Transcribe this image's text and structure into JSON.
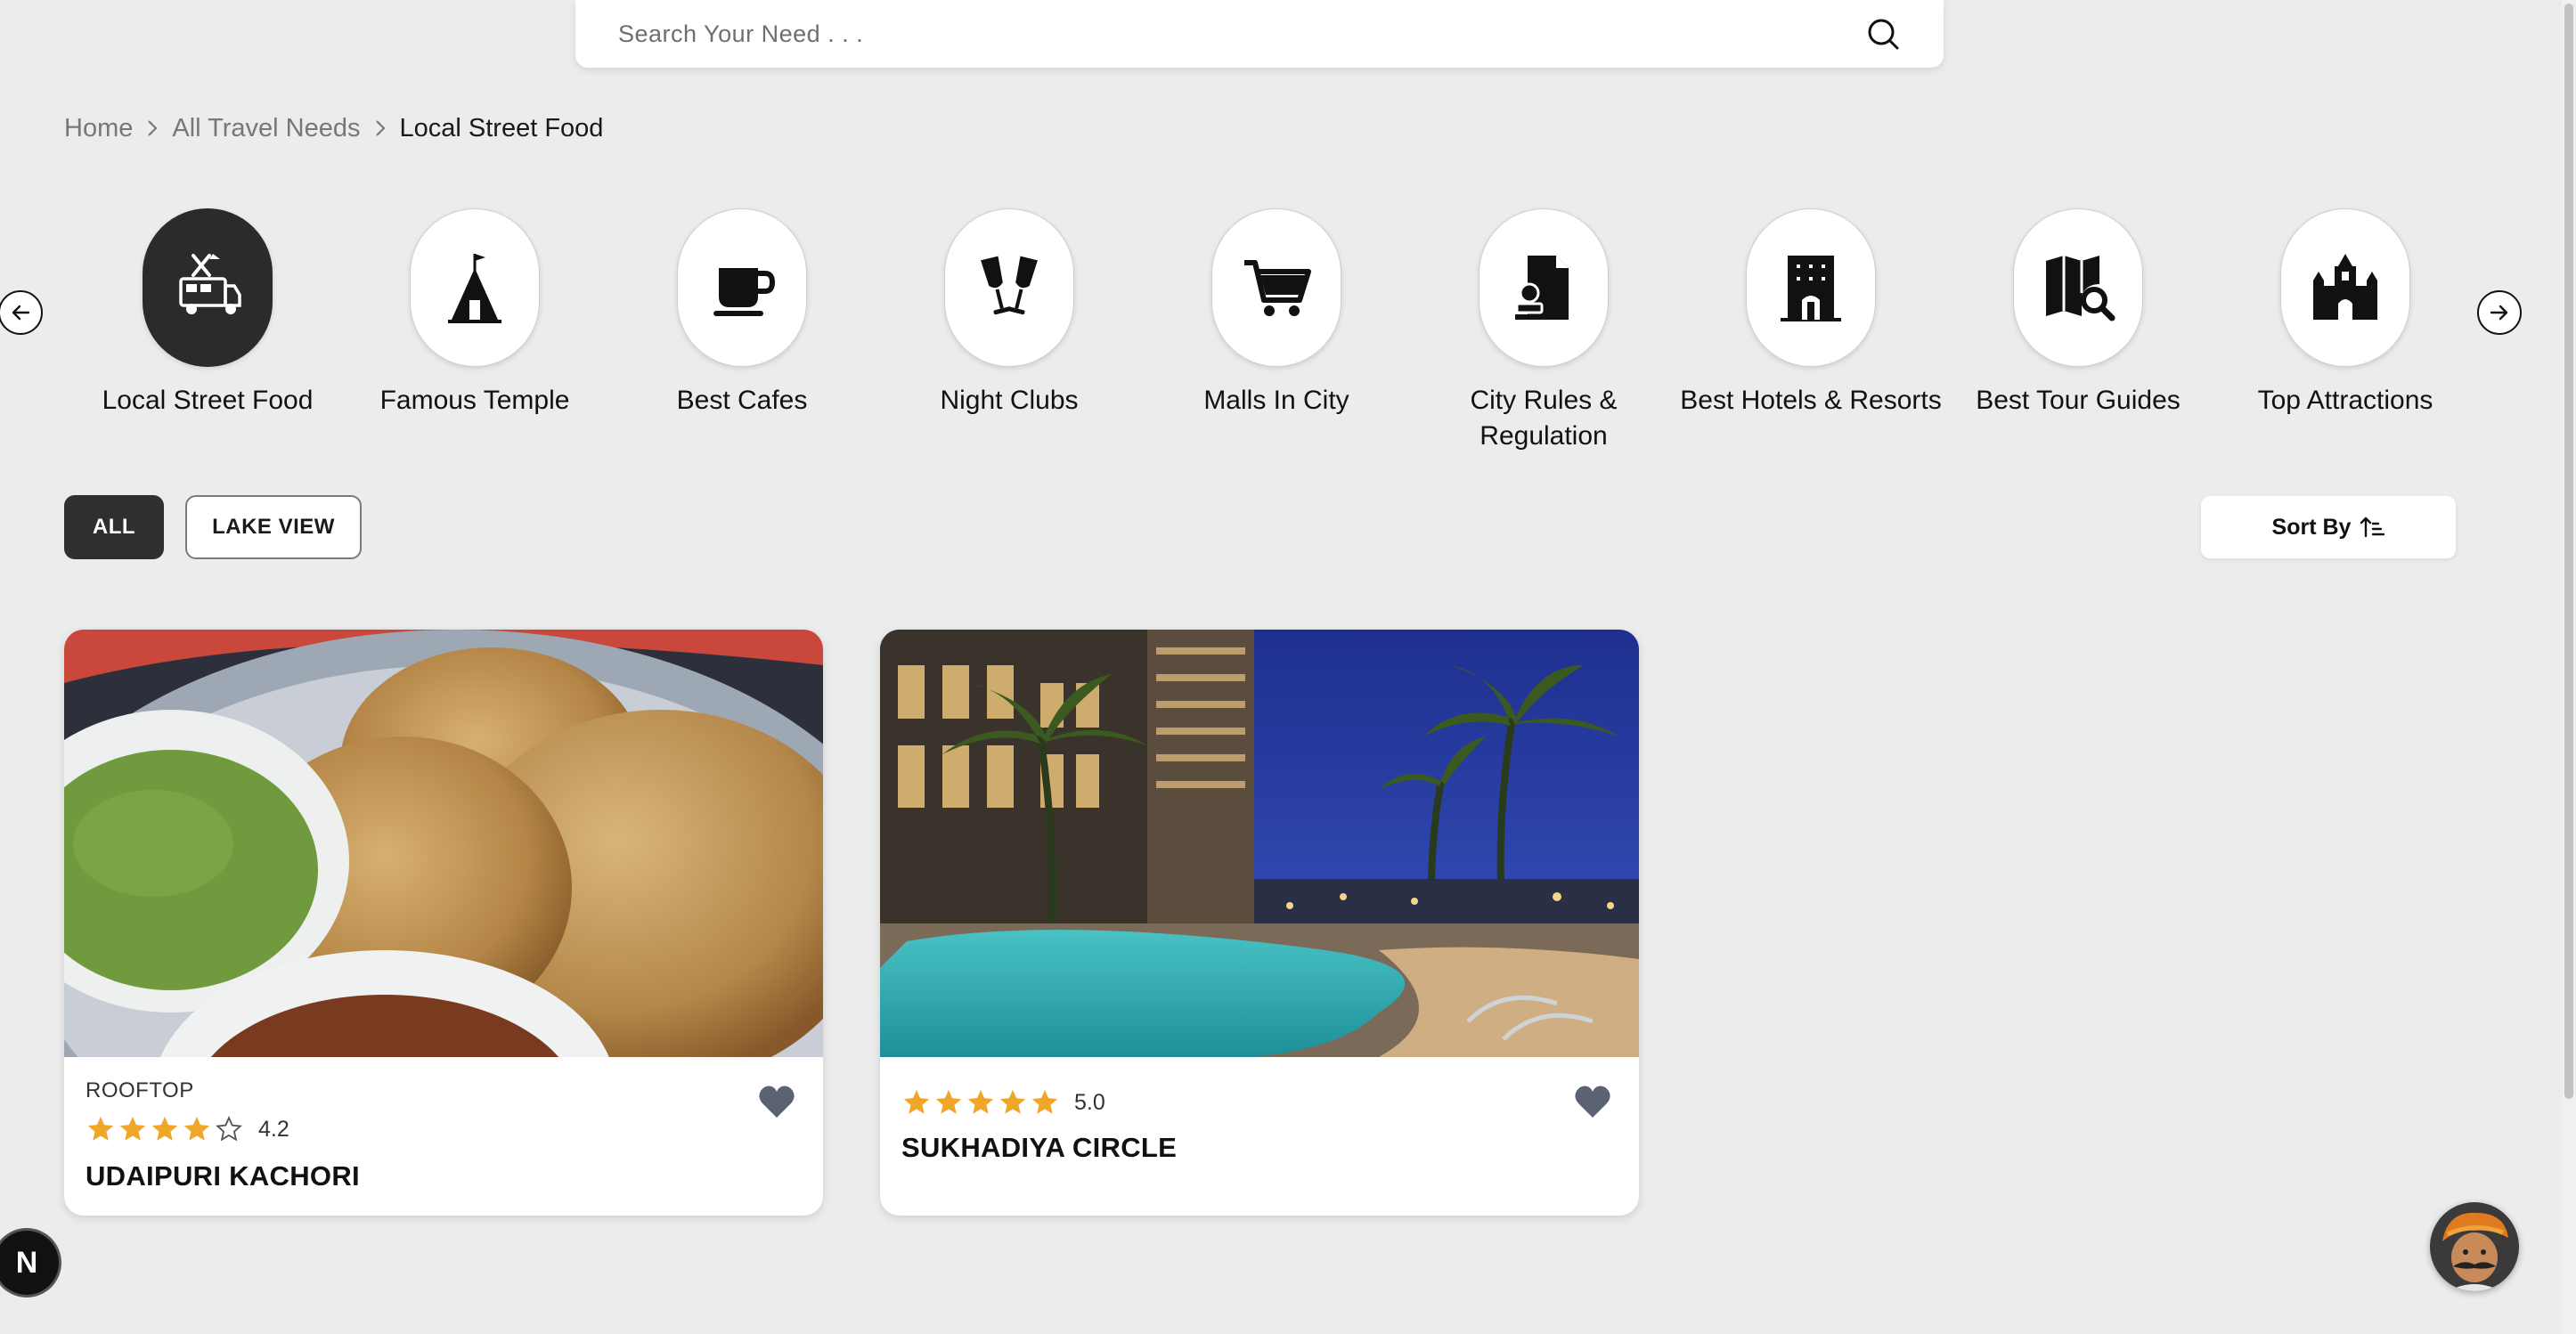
{
  "search": {
    "placeholder": "Search Your Need . . ."
  },
  "breadcrumb": {
    "items": [
      "Home",
      "All Travel Needs",
      "Local Street Food"
    ]
  },
  "categories": [
    {
      "label": "Local Street Food",
      "icon": "food-truck-icon",
      "active": true
    },
    {
      "label": "Famous Temple",
      "icon": "temple-icon"
    },
    {
      "label": "Best Cafes",
      "icon": "coffee-cup-icon"
    },
    {
      "label": "Night Clubs",
      "icon": "cheers-glasses-icon"
    },
    {
      "label": "Malls In City",
      "icon": "shopping-cart-icon"
    },
    {
      "label": "City Rules & Regulation",
      "icon": "document-stamp-icon"
    },
    {
      "label": "Best Hotels & Resorts",
      "icon": "hotel-building-icon"
    },
    {
      "label": "Best Tour Guides",
      "icon": "map-search-icon"
    },
    {
      "label": "Top Attractions",
      "icon": "palace-icon"
    }
  ],
  "filters": {
    "all": "ALL",
    "lake_view": "LAKE VIEW",
    "sort_label": "Sort By"
  },
  "listings": [
    {
      "tag": "ROOFTOP",
      "rating": 4.2,
      "rating_text": "4.2",
      "name": "UDAIPURI KACHORI",
      "image": "kachori-with-chutney-photo"
    },
    {
      "rating": 5.0,
      "rating_text": "5.0",
      "name": "SUKHADIYA CIRCLE",
      "image": "resort-pool-night-photo"
    }
  ],
  "colors": {
    "background": "#ececec",
    "active_chip": "#2f2f2f",
    "star": "#f0a728",
    "heart": "#5b6372"
  },
  "floating": {
    "badge": "N"
  }
}
